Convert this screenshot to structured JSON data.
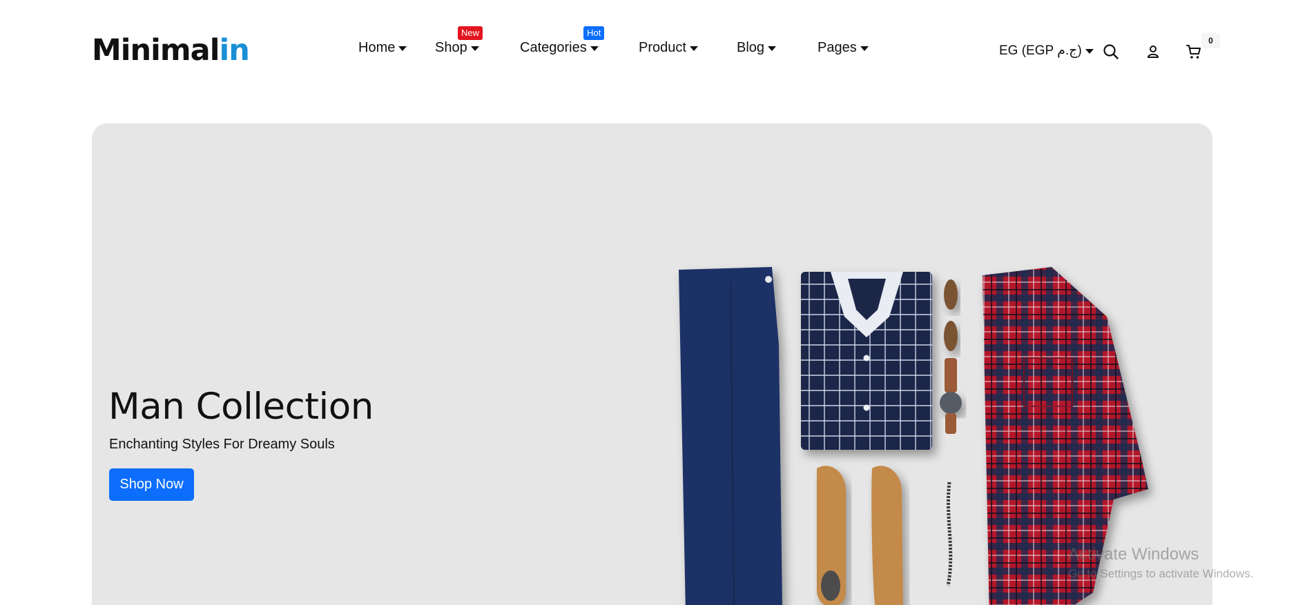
{
  "brand": {
    "logo_part1": "Minimal",
    "logo_part2": "in",
    "accent": "#1a8fd6"
  },
  "nav": [
    {
      "label": "Home"
    },
    {
      "label": "Shop",
      "badge": "New",
      "badge_color": "#e3161f"
    },
    {
      "label": "Categories",
      "badge": "Hot",
      "badge_color": "#0d6efd"
    },
    {
      "label": "Product"
    },
    {
      "label": "Blog"
    },
    {
      "label": "Pages"
    }
  ],
  "header_tools": {
    "currency": "EG (EGP ج.م)",
    "search_icon": "search-icon",
    "account_icon": "user-icon",
    "cart_icon": "cart-icon",
    "cart_count": "0"
  },
  "hero": {
    "title": "Man Collection",
    "subtitle": "Enchanting Styles For Dreamy Souls",
    "cta": "Shop Now",
    "cta_color": "#0d6efd",
    "background": "#e6e6e6"
  },
  "system_watermark": {
    "line1": "Activate Windows",
    "line2": "Go to Settings to activate Windows."
  }
}
